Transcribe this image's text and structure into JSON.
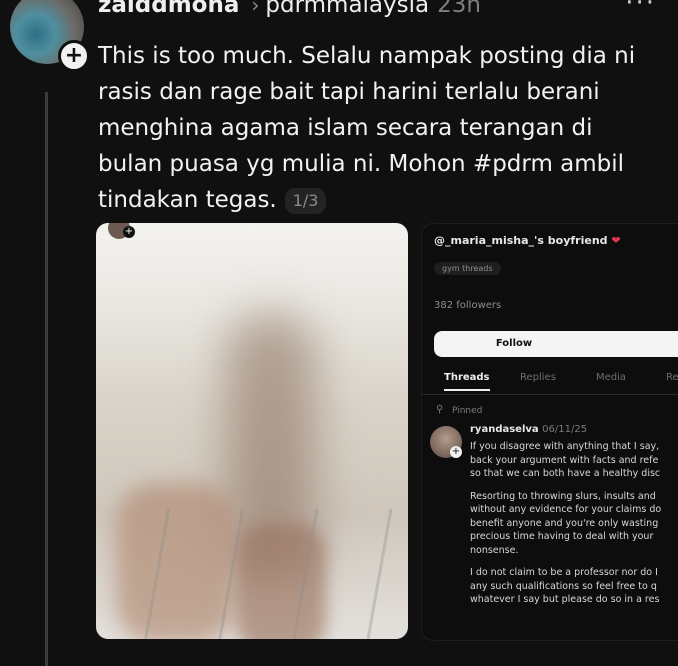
{
  "post": {
    "username": "zaiddmoha",
    "reply_to": "pdrmmalaysia",
    "time": "23h",
    "text": "This is too much. Selalu nampak posting dia ni rasis dan rage bait tapi harini terlalu berani menghina agama islam secara terangan di bulan puasa yg mulia ni. Mohon #pdrm ambil tindakan tegas.",
    "media_counter": "1/3"
  },
  "icons": {
    "more": "more-dots-icon",
    "follow_plus": "plus-icon",
    "chevron": "chevron-right-icon",
    "pin": "pin-icon",
    "heart": "heart-icon"
  },
  "profile_screenshot": {
    "name": "@_maria_misha_'s boyfriend",
    "heart": "❤",
    "tag": "gym threads",
    "followers": "382 followers",
    "follow_label": "Follow",
    "tabs": [
      "Threads",
      "Replies",
      "Media",
      "Re"
    ],
    "pinned_label": "Pinned",
    "reply_user": "ryandaselva",
    "reply_date": "06/11/25",
    "body": [
      [
        "If you disagree with anything that I say,",
        "back your argument with facts and refe",
        "so that we can both have a healthy disc"
      ],
      [
        "Resorting to throwing slurs, insults and",
        "without any evidence for your claims do",
        "benefit anyone and you're only wasting",
        "precious time having to deal with your",
        "nonsense."
      ],
      [
        "I do not claim to be a professor nor do I",
        "any such qualifications so feel free to q",
        "whatever I say but please do so in a res"
      ]
    ]
  },
  "colors": {
    "background": "#101010",
    "text": "#f3f3f3",
    "muted": "#7f7f7f",
    "heart": "#e0334f"
  }
}
